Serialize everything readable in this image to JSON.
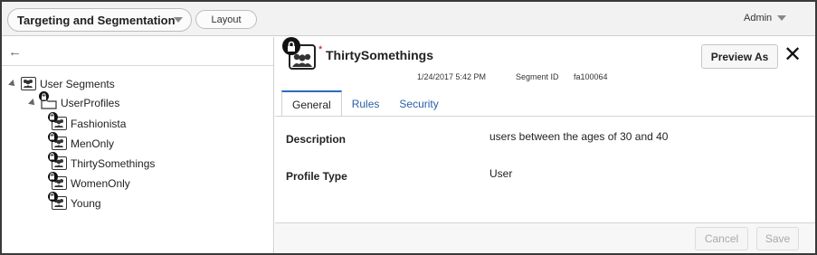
{
  "app": {
    "selector_label": "Targeting and Segmentation",
    "layout_label": "Layout",
    "user_label": "Admin"
  },
  "tree": {
    "root_label": "User Segments",
    "folder_label": "UserProfiles",
    "items": [
      {
        "label": "Fashionista"
      },
      {
        "label": "MenOnly"
      },
      {
        "label": "ThirtySomethings"
      },
      {
        "label": "WomenOnly"
      },
      {
        "label": "Young"
      }
    ]
  },
  "detail": {
    "required_mark": "*",
    "title": "ThirtySomethings",
    "date": "1/24/2017 5:42 PM",
    "segment_id_label": "Segment ID",
    "segment_id": "fa100064",
    "preview_label": "Preview As",
    "close_glyph": "✕",
    "tabs": [
      {
        "label": "General"
      },
      {
        "label": "Rules"
      },
      {
        "label": "Security"
      }
    ],
    "fields": {
      "description_label": "Description",
      "description_value": "users between the ages of 30 and 40",
      "profile_type_label": "Profile Type",
      "profile_type_value": "User"
    },
    "cancel_label": "Cancel",
    "save_label": "Save"
  },
  "icons": {
    "back": "arrow-left-icon",
    "segment": "user-group-icon",
    "lock": "lock-icon",
    "folder": "folder-icon"
  },
  "colors": {
    "tab_accent": "#2a6bbd",
    "link": "#2a5ea8",
    "required": "#cc0000"
  }
}
